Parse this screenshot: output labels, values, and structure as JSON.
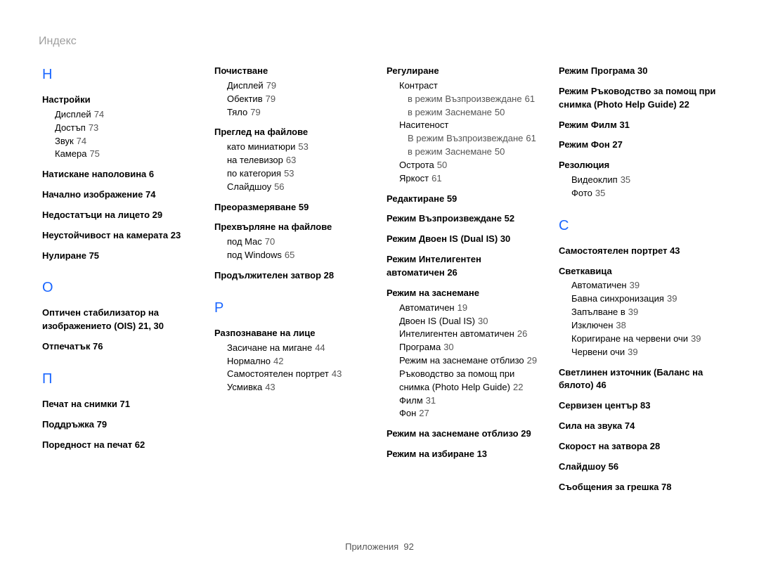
{
  "title": "Индекс",
  "footer": {
    "label": "Приложения",
    "page": "92"
  },
  "letters": {
    "N": "Н",
    "O": "О",
    "P1": "П",
    "R": "Р",
    "S": "С"
  },
  "col1": {
    "nastroyki": {
      "title": "Настройки",
      "items": [
        {
          "label": "Дисплей",
          "pg": "74"
        },
        {
          "label": "Достъп",
          "pg": "73"
        },
        {
          "label": "Звук",
          "pg": "74"
        },
        {
          "label": "Камера",
          "pg": "75"
        }
      ]
    },
    "h2": {
      "label": "Натискане наполовина",
      "pg": "6"
    },
    "h3": {
      "label": "Начално изображение",
      "pg": "74"
    },
    "h4": {
      "label": "Недостатъци на лицето",
      "pg": "29"
    },
    "h5": {
      "label": "Неустойчивост на камерата",
      "pg": "23"
    },
    "h6": {
      "label": "Нулиране",
      "pg": "75"
    },
    "h7": {
      "label": "Оптичен стабилизатор на изображението (OIS)",
      "pg": "21, 30"
    },
    "h8": {
      "label": "Отпечатък",
      "pg": "76"
    },
    "h9": {
      "label": "Печат на снимки",
      "pg": "71"
    },
    "h10": {
      "label": "Поддръжка",
      "pg": "79"
    },
    "h11": {
      "label": "Поредност на печат",
      "pg": "62"
    }
  },
  "col2": {
    "pochistvane": {
      "title": "Почистване",
      "items": [
        {
          "label": "Дисплей",
          "pg": "79"
        },
        {
          "label": "Обектив",
          "pg": "79"
        },
        {
          "label": "Тяло",
          "pg": "79"
        }
      ]
    },
    "pregled": {
      "title": "Преглед на файлове",
      "items": [
        {
          "label": "като миниатюри",
          "pg": "53"
        },
        {
          "label": "на телевизор",
          "pg": "63"
        },
        {
          "label": "по категория",
          "pg": "53"
        },
        {
          "label": "Слайдшоу",
          "pg": "56"
        }
      ]
    },
    "h3": {
      "label": "Преоразмеряване",
      "pg": "59"
    },
    "prehv": {
      "title": "Прехвърляне на файлове",
      "items": [
        {
          "label": "под Mac",
          "pg": "70"
        },
        {
          "label": "под Windows",
          "pg": "65"
        }
      ]
    },
    "h5": {
      "label": "Продължителен затвор",
      "pg": "28"
    },
    "razp": {
      "title": "Разпознаване на лице",
      "items": [
        {
          "label": "Засичане на мигане",
          "pg": "44"
        },
        {
          "label": "Нормално",
          "pg": "42"
        },
        {
          "label": "Самостоятелен портрет",
          "pg": "43"
        },
        {
          "label": "Усмивка",
          "pg": "43"
        }
      ]
    }
  },
  "col3": {
    "regul": {
      "title": "Регулиране",
      "kontrast": {
        "label": "Контраст",
        "items": [
          {
            "label": "в режим Възпроизвеждане",
            "pg": "61"
          },
          {
            "label": "в режим Заснемане",
            "pg": "50"
          }
        ]
      },
      "nasit": {
        "label": "Наситеност",
        "items": [
          {
            "label": "В режим Възпроизвеждане",
            "pg": "61"
          },
          {
            "label": "в режим Заснемане",
            "pg": "50"
          }
        ]
      },
      "ostrota": {
        "label": "Острота",
        "pg": "50"
      },
      "yarkost": {
        "label": "Яркост",
        "pg": "61"
      }
    },
    "h2": {
      "label": "Редактиране",
      "pg": "59"
    },
    "h3": {
      "label": "Режим Възпроизвеждане",
      "pg": "52"
    },
    "h4": {
      "label": "Режим Двоен IS (Dual IS)",
      "pg": "30"
    },
    "h5": {
      "label": "Режим Интелигентен автоматичен",
      "pg": "26"
    },
    "zasn": {
      "title": "Режим на заснемане",
      "items": [
        {
          "label": "Автоматичен",
          "pg": "19"
        },
        {
          "label": "Двоен IS (Dual IS)",
          "pg": "30"
        },
        {
          "label": "Интелигентен автоматичен",
          "pg": "26"
        },
        {
          "label": "Програма",
          "pg": "30"
        },
        {
          "label": "Режим на заснемане отблизо",
          "pg": "29"
        },
        {
          "label": "Ръководство за помощ при снимка (Photo Help Guide)",
          "pg": "22"
        },
        {
          "label": "Филм",
          "pg": "31"
        },
        {
          "label": "Фон",
          "pg": "27"
        }
      ]
    },
    "h7": {
      "label": "Режим на заснемане отблизо",
      "pg": "29"
    },
    "h8": {
      "label": "Режим на избиране",
      "pg": "13"
    }
  },
  "col4": {
    "h1": {
      "label": "Режим Програма",
      "pg": "30"
    },
    "h2": {
      "label": "Режим Ръководство за помощ при снимка (Photo Help Guide)",
      "pg": "22"
    },
    "h3": {
      "label": "Режим Филм",
      "pg": "31"
    },
    "h4": {
      "label": "Режим Фон",
      "pg": "27"
    },
    "rez": {
      "title": "Резолюция",
      "items": [
        {
          "label": "Видеоклип",
          "pg": "35"
        },
        {
          "label": "Фото",
          "pg": "35"
        }
      ]
    },
    "h6": {
      "label": "Самостоятелен портрет",
      "pg": "43"
    },
    "svet": {
      "title": "Светкавица",
      "items": [
        {
          "label": "Автоматичен",
          "pg": "39"
        },
        {
          "label": "Бавна синхронизация",
          "pg": "39"
        },
        {
          "label": "Запълване в",
          "pg": "39"
        },
        {
          "label": "Изключен",
          "pg": "38"
        },
        {
          "label": "Коригиране на червени очи",
          "pg": "39"
        },
        {
          "label": "Червени очи",
          "pg": "39"
        }
      ]
    },
    "h8": {
      "label": "Светлинен източник (Баланс на бялото)",
      "pg": "46"
    },
    "h9": {
      "label": "Сервизен център",
      "pg": "83"
    },
    "h10": {
      "label": "Сила на звука",
      "pg": "74"
    },
    "h11": {
      "label": "Скорост на затвора",
      "pg": "28"
    },
    "h12": {
      "label": "Слайдшоу",
      "pg": "56"
    },
    "h13": {
      "label": "Съобщения за грешка",
      "pg": "78"
    }
  }
}
